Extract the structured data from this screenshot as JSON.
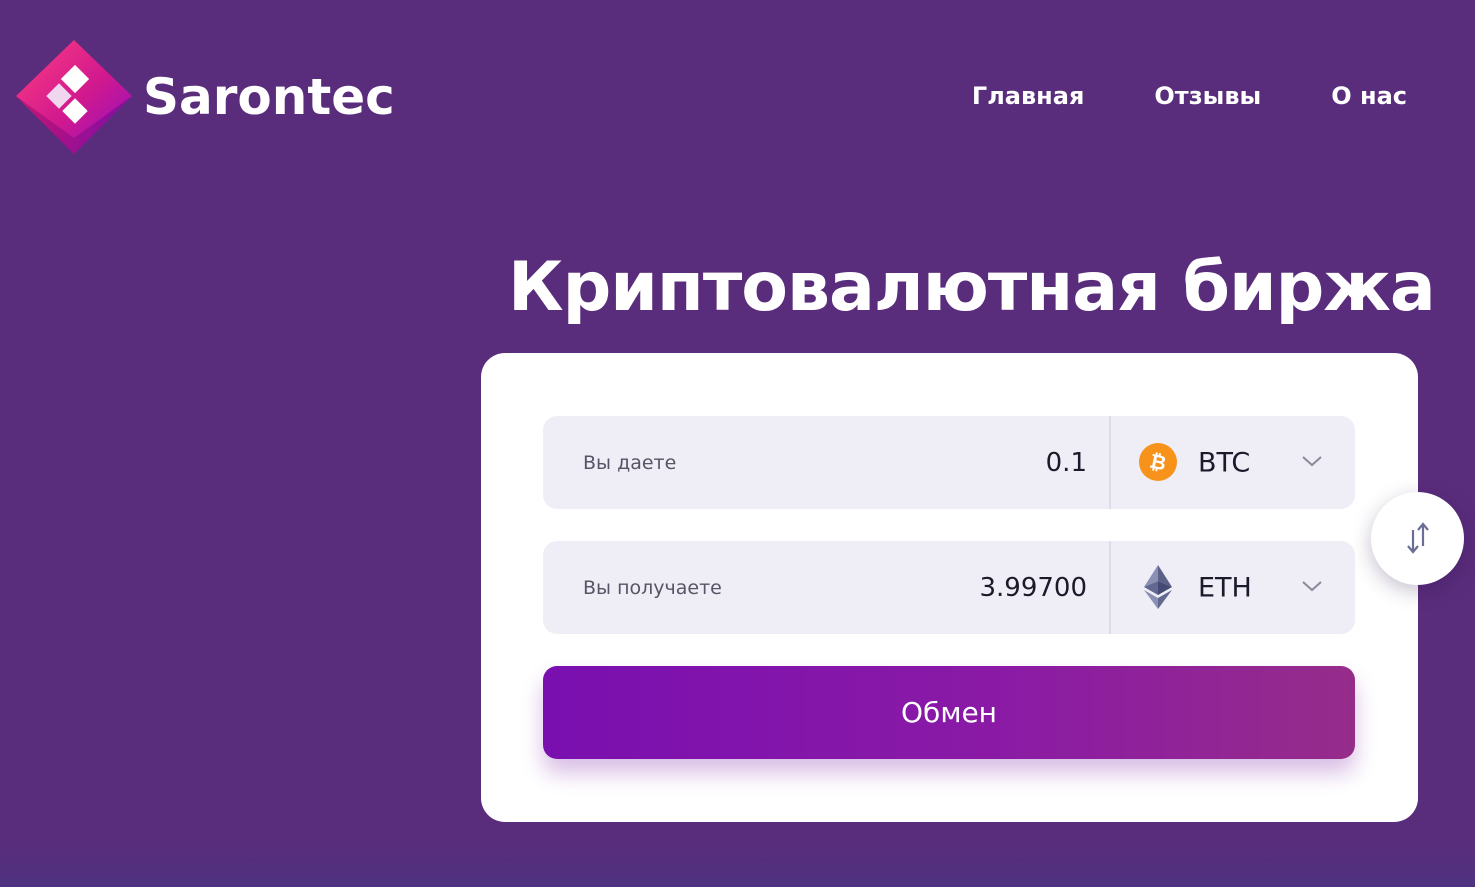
{
  "brand": {
    "name": "Sarontec",
    "logo_icon": "diamond-logo-icon",
    "colors": {
      "primary": "#e33a8e",
      "secondary": "#9b1bd1"
    }
  },
  "nav": {
    "items": [
      {
        "label": "Главная"
      },
      {
        "label": "Отзывы"
      },
      {
        "label": "О нас"
      }
    ]
  },
  "hero": {
    "title": "Криптовалютная биржа"
  },
  "exchange": {
    "give": {
      "label": "Вы даете",
      "amount": "0.1",
      "currency": "BTC",
      "currency_icon": "bitcoin-icon",
      "icon_color": "#f7931a"
    },
    "get": {
      "label": "Вы получаете",
      "amount": "3.99700",
      "currency": "ETH",
      "currency_icon": "ethereum-icon",
      "icon_color": "#62688f"
    },
    "swap_icon": "swap-arrows-icon",
    "submit_label": "Обмен"
  },
  "theme": {
    "background": "#5a2d7c",
    "button_gradient_start": "#7a0fb0",
    "button_gradient_end": "#962c8a"
  }
}
